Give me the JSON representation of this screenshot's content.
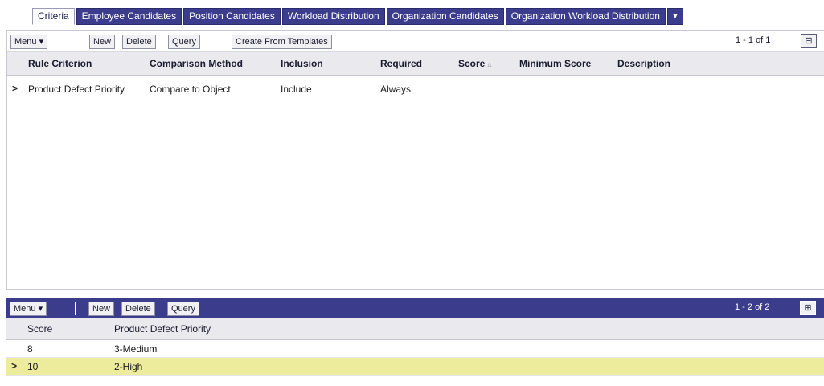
{
  "tabs": [
    {
      "label": "Criteria",
      "active": true
    },
    {
      "label": "Employee Candidates",
      "active": false
    },
    {
      "label": "Position Candidates",
      "active": false
    },
    {
      "label": "Workload Distribution",
      "active": false
    },
    {
      "label": "Organization Candidates",
      "active": false
    },
    {
      "label": "Organization Workload Distribution",
      "active": false
    }
  ],
  "tabs_more_icon": "chevron-down-icon",
  "upper": {
    "toolbar": {
      "menu_label": "Menu ▾",
      "new_label": "New",
      "delete_label": "Delete",
      "query_label": "Query",
      "create_templates_label": "Create From Templates",
      "record_count": "1 - 1 of 1",
      "toggle_icon": "collapse-list-icon"
    },
    "columns": [
      "Rule Criterion",
      "Comparison Method",
      "Inclusion",
      "Required",
      "Score",
      "Minimum Score",
      "Description"
    ],
    "sort_indicator": "▵",
    "rows": [
      {
        "rule_criterion": "Product Defect Priority",
        "comparison_method": "Compare to Object",
        "inclusion": "Include",
        "required": "Always",
        "score": "",
        "minimum_score": "",
        "description": "",
        "selected": true
      }
    ]
  },
  "lower": {
    "toolbar": {
      "menu_label": "Menu ▾",
      "new_label": "New",
      "delete_label": "Delete",
      "query_label": "Query",
      "record_count": "1 - 2 of 2",
      "toggle_icon": "expand-list-icon"
    },
    "columns": [
      "Score",
      "Product Defect Priority"
    ],
    "rows": [
      {
        "score": "8",
        "priority": "3-Medium",
        "selected": false
      },
      {
        "score": "10",
        "priority": "2-High",
        "selected": true
      }
    ]
  },
  "colors": {
    "tab_bg": "#3c3c8c",
    "applet_toolbar_bg": "#3c3c8c",
    "selected_row_bg": "#ecec9c",
    "header_bg": "#e9e9ee"
  }
}
